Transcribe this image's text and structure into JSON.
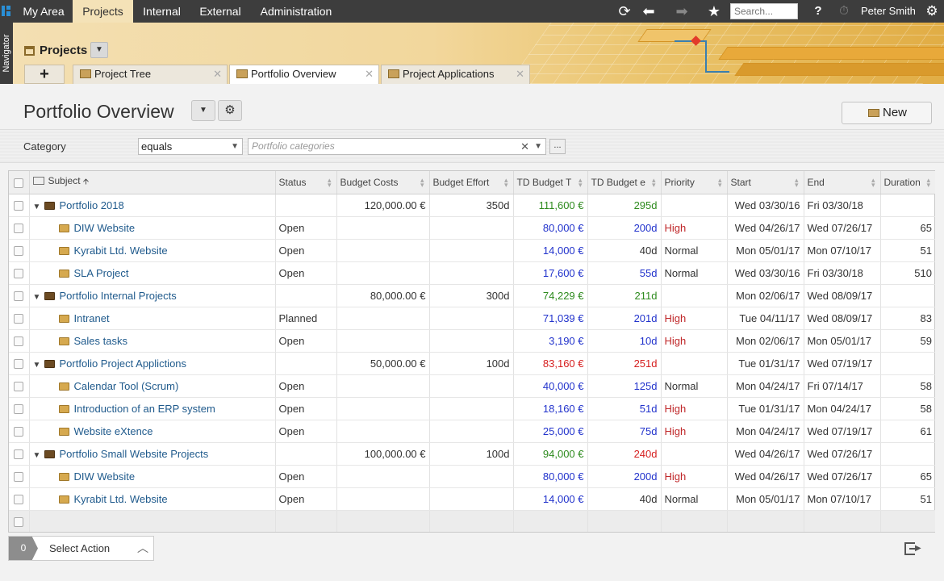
{
  "topnav": {
    "tabs": [
      "My Area",
      "Projects",
      "Internal",
      "External",
      "Administration"
    ],
    "active_tab": "Projects",
    "search_placeholder": "Search...",
    "user_name": "Peter Smith",
    "help_label": "?"
  },
  "sidebar": {
    "label": "Navigator"
  },
  "module": {
    "title": "Projects",
    "add_tab_label": "+",
    "tabs": [
      {
        "label": "Project Tree"
      },
      {
        "label": "Portfolio Overview"
      },
      {
        "label": "Project Applications"
      }
    ],
    "active_tab": "Portfolio Overview"
  },
  "page": {
    "title": "Portfolio Overview",
    "new_button": "New"
  },
  "filter": {
    "label": "Category",
    "operator": "equals",
    "placeholder": "Portfolio categories",
    "more_label": "..."
  },
  "table": {
    "columns": [
      "Subject",
      "Status",
      "Budget Costs",
      "Budget Effort",
      "TD Budget T",
      "TD Budget e",
      "Priority",
      "Start",
      "End",
      "Duration"
    ],
    "rows": [
      {
        "level": 0,
        "subject": "Portfolio 2018",
        "status": "",
        "budget_costs": "120,000.00 €",
        "budget_effort": "350d",
        "td_budget_t": "111,600 €",
        "td_budget_t_color": "green",
        "td_budget_e": "295d",
        "td_budget_e_color": "green",
        "priority": "",
        "start": "Wed 03/30/16",
        "end": "Fri 03/30/18",
        "duration": ""
      },
      {
        "level": 1,
        "subject": "DIW Website",
        "status": "Open",
        "budget_costs": "",
        "budget_effort": "",
        "td_budget_t": "80,000 €",
        "td_budget_t_color": "blue",
        "td_budget_e": "200d",
        "td_budget_e_color": "blue",
        "priority": "High",
        "start": "Wed 04/26/17",
        "end": "Wed 07/26/17",
        "duration": "65"
      },
      {
        "level": 1,
        "subject": "Kyrabit Ltd. Website",
        "status": "Open",
        "budget_costs": "",
        "budget_effort": "",
        "td_budget_t": "14,000 €",
        "td_budget_t_color": "blue",
        "td_budget_e": "40d",
        "td_budget_e_color": "plain",
        "priority": "Normal",
        "start": "Mon 05/01/17",
        "end": "Mon 07/10/17",
        "duration": "51"
      },
      {
        "level": 1,
        "subject": "SLA Project",
        "status": "Open",
        "budget_costs": "",
        "budget_effort": "",
        "td_budget_t": "17,600 €",
        "td_budget_t_color": "blue",
        "td_budget_e": "55d",
        "td_budget_e_color": "blue",
        "priority": "Normal",
        "start": "Wed 03/30/16",
        "end": "Fri 03/30/18",
        "duration": "510"
      },
      {
        "level": 0,
        "subject": "Portfolio Internal Projects",
        "status": "",
        "budget_costs": "80,000.00 €",
        "budget_effort": "300d",
        "td_budget_t": "74,229 €",
        "td_budget_t_color": "green",
        "td_budget_e": "211d",
        "td_budget_e_color": "green",
        "priority": "",
        "start": "Mon 02/06/17",
        "end": "Wed 08/09/17",
        "duration": ""
      },
      {
        "level": 1,
        "subject": "Intranet",
        "status": "Planned",
        "budget_costs": "",
        "budget_effort": "",
        "td_budget_t": "71,039 €",
        "td_budget_t_color": "blue",
        "td_budget_e": "201d",
        "td_budget_e_color": "blue",
        "priority": "High",
        "start": "Tue 04/11/17",
        "end": "Wed 08/09/17",
        "duration": "83"
      },
      {
        "level": 1,
        "subject": "Sales tasks",
        "status": "Open",
        "budget_costs": "",
        "budget_effort": "",
        "td_budget_t": "3,190 €",
        "td_budget_t_color": "blue",
        "td_budget_e": "10d",
        "td_budget_e_color": "blue",
        "priority": "High",
        "start": "Mon 02/06/17",
        "end": "Mon 05/01/17",
        "duration": "59"
      },
      {
        "level": 0,
        "subject": "Portfolio Project Applictions",
        "status": "",
        "budget_costs": "50,000.00 €",
        "budget_effort": "100d",
        "td_budget_t": "83,160 €",
        "td_budget_t_color": "red",
        "td_budget_e": "251d",
        "td_budget_e_color": "red",
        "priority": "",
        "start": "Tue 01/31/17",
        "end": "Wed 07/19/17",
        "duration": ""
      },
      {
        "level": 1,
        "subject": "Calendar Tool (Scrum)",
        "status": "Open",
        "budget_costs": "",
        "budget_effort": "",
        "td_budget_t": "40,000 €",
        "td_budget_t_color": "blue",
        "td_budget_e": "125d",
        "td_budget_e_color": "blue",
        "priority": "Normal",
        "start": "Mon 04/24/17",
        "end": "Fri 07/14/17",
        "duration": "58"
      },
      {
        "level": 1,
        "subject": "Introduction of an ERP system",
        "status": "Open",
        "budget_costs": "",
        "budget_effort": "",
        "td_budget_t": "18,160 €",
        "td_budget_t_color": "blue",
        "td_budget_e": "51d",
        "td_budget_e_color": "blue",
        "priority": "High",
        "start": "Tue 01/31/17",
        "end": "Mon 04/24/17",
        "duration": "58"
      },
      {
        "level": 1,
        "subject": "Website eXtence",
        "status": "Open",
        "budget_costs": "",
        "budget_effort": "",
        "td_budget_t": "25,000 €",
        "td_budget_t_color": "blue",
        "td_budget_e": "75d",
        "td_budget_e_color": "blue",
        "priority": "High",
        "start": "Mon 04/24/17",
        "end": "Wed 07/19/17",
        "duration": "61"
      },
      {
        "level": 0,
        "subject": "Portfolio Small Website Projects",
        "status": "",
        "budget_costs": "100,000.00 €",
        "budget_effort": "100d",
        "td_budget_t": "94,000 €",
        "td_budget_t_color": "green",
        "td_budget_e": "240d",
        "td_budget_e_color": "red",
        "priority": "",
        "start": "Wed 04/26/17",
        "end": "Wed 07/26/17",
        "duration": ""
      },
      {
        "level": 1,
        "subject": "DIW Website",
        "status": "Open",
        "budget_costs": "",
        "budget_effort": "",
        "td_budget_t": "80,000 €",
        "td_budget_t_color": "blue",
        "td_budget_e": "200d",
        "td_budget_e_color": "blue",
        "priority": "High",
        "start": "Wed 04/26/17",
        "end": "Wed 07/26/17",
        "duration": "65"
      },
      {
        "level": 1,
        "subject": "Kyrabit Ltd. Website",
        "status": "Open",
        "budget_costs": "",
        "budget_effort": "",
        "td_budget_t": "14,000 €",
        "td_budget_t_color": "blue",
        "td_budget_e": "40d",
        "td_budget_e_color": "plain",
        "priority": "Normal",
        "start": "Mon 05/01/17",
        "end": "Mon 07/10/17",
        "duration": "51"
      }
    ]
  },
  "footer": {
    "selected_count": "0",
    "select_action_label": "Select Action"
  },
  "colors": {
    "topbar": "#3d3d3d",
    "active_tab": "#f4e2b7",
    "link": "#1f5a8c",
    "value_blue": "#2233cc",
    "value_green": "#2e8b1e",
    "value_red": "#d62020",
    "priority_high": "#c0282a"
  }
}
